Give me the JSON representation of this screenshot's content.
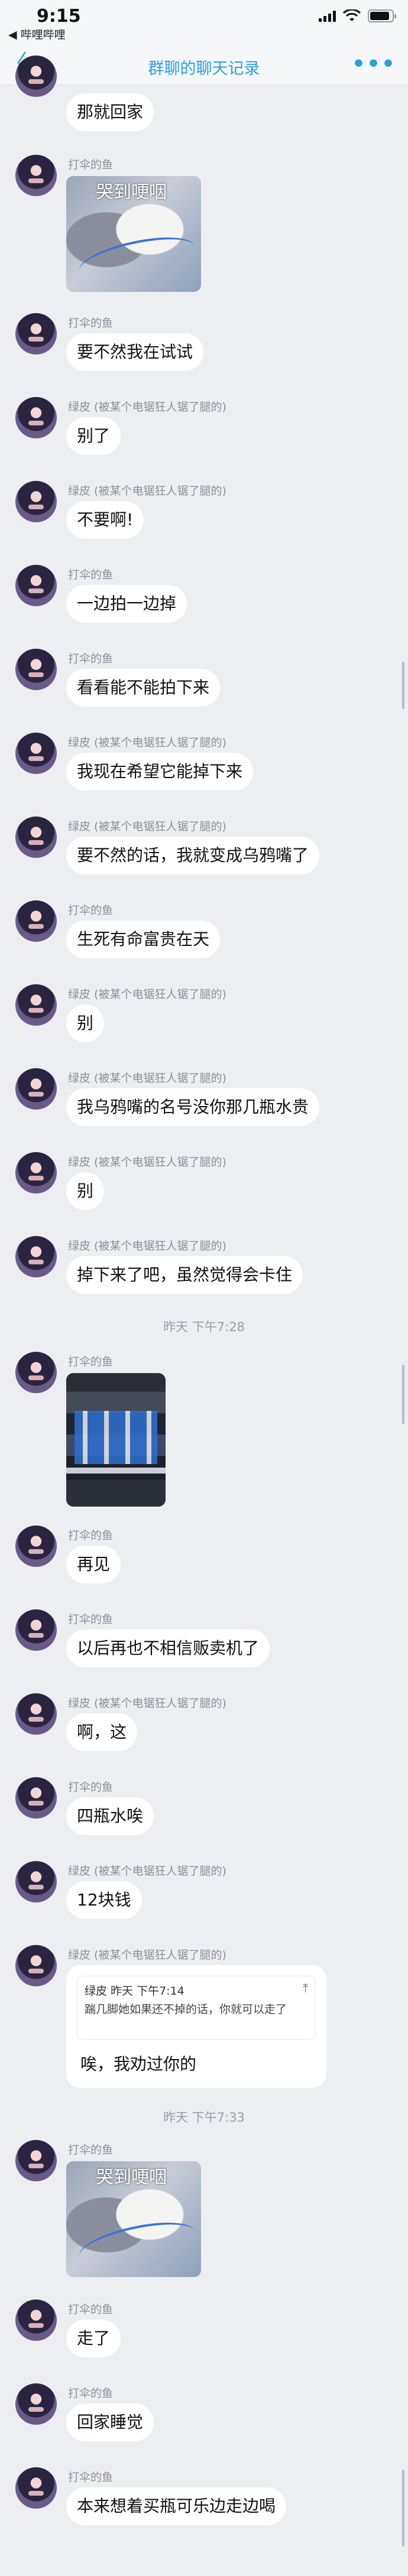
{
  "status": {
    "time": "9:15",
    "back_app": "◀ 哔哩哔哩"
  },
  "nav": {
    "back_glyph": "〈",
    "title": "群聊的聊天记录",
    "more_glyph": "•••"
  },
  "senders": {
    "a": "打伞的鱼",
    "b": "绿皮 (被某个电锯狂人锯了腿的)"
  },
  "messages": [
    {
      "sender": "",
      "text": "那就回家"
    },
    {
      "sender": "打伞的鱼",
      "image": "cat",
      "image_text": "哭到哽咽"
    },
    {
      "sender": "打伞的鱼",
      "text": "要不然我在试试"
    },
    {
      "sender": "绿皮 (被某个电锯狂人锯了腿的)",
      "text": "别了"
    },
    {
      "sender": "绿皮 (被某个电锯狂人锯了腿的)",
      "text": "不要啊!"
    },
    {
      "sender": "打伞的鱼",
      "text": "一边拍一边掉"
    },
    {
      "sender": "打伞的鱼",
      "text": "看看能不能拍下来"
    },
    {
      "sender": "绿皮 (被某个电锯狂人锯了腿的)",
      "text": "我现在希望它能掉下来"
    },
    {
      "sender": "绿皮 (被某个电锯狂人锯了腿的)",
      "text": "要不然的话，我就变成乌鸦嘴了"
    },
    {
      "sender": "打伞的鱼",
      "text": "生死有命富贵在天"
    },
    {
      "sender": "绿皮 (被某个电锯狂人锯了腿的)",
      "text": "别"
    },
    {
      "sender": "绿皮 (被某个电锯狂人锯了腿的)",
      "text": "我乌鸦嘴的名号没你那几瓶水贵"
    },
    {
      "sender": "绿皮 (被某个电锯狂人锯了腿的)",
      "text": "别"
    },
    {
      "sender": "绿皮 (被某个电锯狂人锯了腿的)",
      "text": "掉下来了吧，虽然觉得会卡住"
    },
    {
      "sender": "打伞的鱼",
      "image": "vending"
    },
    {
      "sender": "打伞的鱼",
      "text": "再见"
    },
    {
      "sender": "打伞的鱼",
      "text": "以后再也不相信贩卖机了"
    },
    {
      "sender": "绿皮 (被某个电锯狂人锯了腿的)",
      "text": "啊，这"
    },
    {
      "sender": "打伞的鱼",
      "text": "四瓶水唉"
    },
    {
      "sender": "绿皮 (被某个电锯狂人锯了腿的)",
      "text": "12块钱"
    },
    {
      "sender": "绿皮 (被某个电锯狂人锯了腿的)",
      "quote_head": "绿皮 昨天 下午7:14",
      "quote_body": "踹几脚她如果还不掉的话，你就可以走了",
      "quote_pin": "⤒",
      "text": "唉，我劝过你的"
    },
    {
      "sender": "打伞的鱼",
      "image": "cat",
      "image_text": "哭到哽咽"
    },
    {
      "sender": "打伞的鱼",
      "text": "走了"
    },
    {
      "sender": "打伞的鱼",
      "text": "回家睡觉"
    },
    {
      "sender": "打伞的鱼",
      "text": "本来想着买瓶可乐边走边喝"
    }
  ],
  "timestamps": [
    "昨天 下午7:28",
    "昨天 下午7:33"
  ],
  "colors": {
    "accent": "#2b9fe4",
    "background": "#eceef2",
    "bubble": "#ffffff"
  }
}
